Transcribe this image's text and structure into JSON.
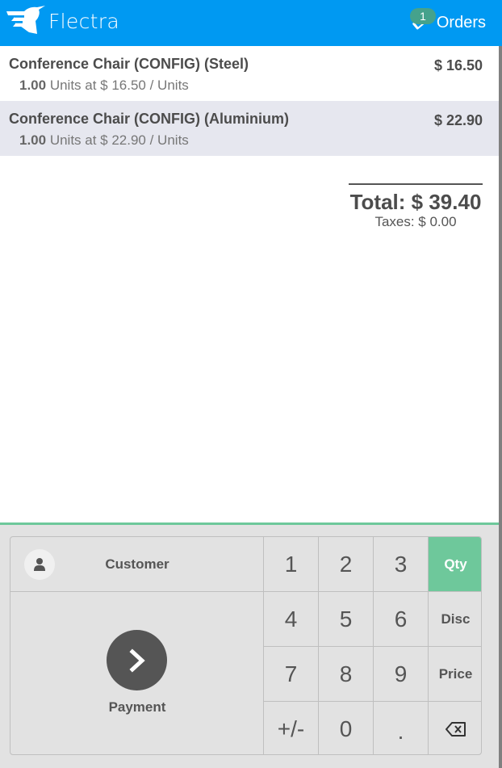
{
  "header": {
    "brand": "Flectra",
    "orders_label": "Orders",
    "orders_count": "1",
    "colors": {
      "background": "#0099f2",
      "badge": "#45a28c"
    }
  },
  "orderlines": [
    {
      "name": "Conference Chair (CONFIG) (Steel)",
      "price": "$ 16.50",
      "quantity": "1.00",
      "unit_info": " Units at $ 16.50 / Units",
      "selected": false
    },
    {
      "name": "Conference Chair (CONFIG) (Aluminium)",
      "price": "$ 22.90",
      "quantity": "1.00",
      "unit_info": " Units at $ 22.90 / Units",
      "selected": true
    }
  ],
  "summary": {
    "total": "Total: $ 39.40",
    "taxes": "Taxes: $ 0.00"
  },
  "actionpad": {
    "customer_label": "Customer",
    "payment_label": "Payment"
  },
  "numpad": {
    "keys": [
      "1",
      "2",
      "3",
      "4",
      "5",
      "6",
      "7",
      "8",
      "9",
      "+/-",
      "0",
      "."
    ],
    "modes": [
      "Qty",
      "Disc",
      "Price"
    ],
    "active_mode": "Qty",
    "backspace_icon": "backspace-icon",
    "accent_color": "#6ec89b"
  }
}
